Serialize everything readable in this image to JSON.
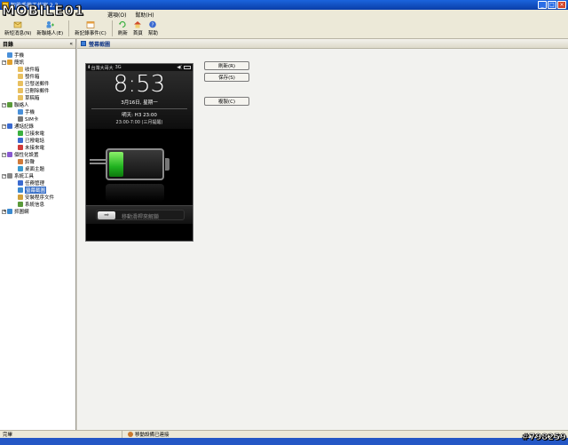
{
  "window": {
    "title": "智能手機工作室 2.3",
    "controls": [
      "_",
      "□",
      "×"
    ],
    "icon": "app-icon"
  },
  "watermark": {
    "logo": "MOBILE01",
    "id_text": "#798259"
  },
  "menubar": {
    "items": [
      "選項(O)",
      "幫助(H)"
    ]
  },
  "toolbar": {
    "buttons": [
      {
        "label": "新短消息(N)",
        "icon": "new-message-icon"
      },
      {
        "label": "新聯絡人(E)",
        "icon": "new-contact-icon"
      },
      {
        "label": "新記錄事件(C)",
        "icon": "new-event-icon"
      },
      {
        "label": "刷新",
        "icon": "refresh-icon"
      },
      {
        "label": "首頁",
        "icon": "home-icon"
      },
      {
        "label": "幫助",
        "icon": "help-icon"
      }
    ]
  },
  "left_panel": {
    "header": "目錄",
    "collapse": "«",
    "tree": [
      {
        "label": "手機",
        "depth": 0,
        "expander": "",
        "icon": "phone-icon",
        "color": "#4a90d9"
      },
      {
        "label": "簡訊",
        "depth": 0,
        "expander": "−",
        "icon": "sms-icon",
        "color": "#e0a030"
      },
      {
        "label": "收件箱",
        "depth": 2,
        "expander": "",
        "icon": "inbox-icon",
        "color": "#e8c060"
      },
      {
        "label": "發件箱",
        "depth": 2,
        "expander": "",
        "icon": "outbox-icon",
        "color": "#e8c060"
      },
      {
        "label": "已發送郵件",
        "depth": 2,
        "expander": "",
        "icon": "sent-icon",
        "color": "#e8c060"
      },
      {
        "label": "已刪除郵件",
        "depth": 2,
        "expander": "",
        "icon": "deleted-icon",
        "color": "#e8c060"
      },
      {
        "label": "草稿箱",
        "depth": 2,
        "expander": "",
        "icon": "drafts-icon",
        "color": "#e8c060"
      },
      {
        "label": "聯絡人",
        "depth": 0,
        "expander": "−",
        "icon": "contacts-icon",
        "color": "#5a9a3a"
      },
      {
        "label": "手機",
        "depth": 2,
        "expander": "",
        "icon": "phone-contacts-icon",
        "color": "#4a90d9"
      },
      {
        "label": "SIM卡",
        "depth": 2,
        "expander": "",
        "icon": "sim-icon",
        "color": "#777777"
      },
      {
        "label": "通話記錄",
        "depth": 0,
        "expander": "−",
        "icon": "call-log-icon",
        "color": "#3a6ad0"
      },
      {
        "label": "已接來電",
        "depth": 2,
        "expander": "",
        "icon": "received-call-icon",
        "color": "#3ab040"
      },
      {
        "label": "已撥電話",
        "depth": 2,
        "expander": "",
        "icon": "dialed-call-icon",
        "color": "#3a6ad0"
      },
      {
        "label": "未接來電",
        "depth": 2,
        "expander": "",
        "icon": "missed-call-icon",
        "color": "#d03a3a"
      },
      {
        "label": "個性化設置",
        "depth": 0,
        "expander": "−",
        "icon": "personalize-icon",
        "color": "#8a5ad0"
      },
      {
        "label": "鈴聲",
        "depth": 2,
        "expander": "",
        "icon": "ringtone-icon",
        "color": "#d07a3a"
      },
      {
        "label": "桌面主題",
        "depth": 2,
        "expander": "",
        "icon": "theme-icon",
        "color": "#3a9ad0"
      },
      {
        "label": "系統工具",
        "depth": 0,
        "expander": "−",
        "icon": "system-tools-icon",
        "color": "#888888"
      },
      {
        "label": "任務管理",
        "depth": 2,
        "expander": "",
        "icon": "task-manager-icon",
        "color": "#3a6ad0"
      },
      {
        "label": "螢幕截圖",
        "depth": 2,
        "expander": "",
        "icon": "screenshot-icon",
        "color": "#3a8ad0",
        "selected": true
      },
      {
        "label": "安裝程序文件",
        "depth": 2,
        "expander": "",
        "icon": "installer-icon",
        "color": "#d0a03a"
      },
      {
        "label": "系統信息",
        "depth": 2,
        "expander": "",
        "icon": "system-info-icon",
        "color": "#5a9a3a"
      },
      {
        "label": "抓圖網",
        "depth": 0,
        "expander": "+",
        "icon": "web-icon",
        "color": "#3a8ad0"
      }
    ]
  },
  "right_panel": {
    "header": "螢幕截圖",
    "buttons": [
      "刷新(R)",
      "保存(S)",
      "複製(C)"
    ]
  },
  "phone_screen": {
    "status": {
      "signal": "ıllı",
      "carrier": "台灣大哥大",
      "network": "3G",
      "volume": "◀(",
      "battery": "battery-icon"
    },
    "time": "8:53",
    "date": "3月16日, 星期一",
    "weather": "明天: H3 23:00",
    "schedule": "23:00-7:00 (三月提醒)",
    "battery_charge": 0.25,
    "slider_text": "移動滑桿來解鎖",
    "slider_icon": "arrow-right-icon"
  },
  "statusbar": {
    "left": "完畢",
    "middle": "移動設備已連接"
  }
}
